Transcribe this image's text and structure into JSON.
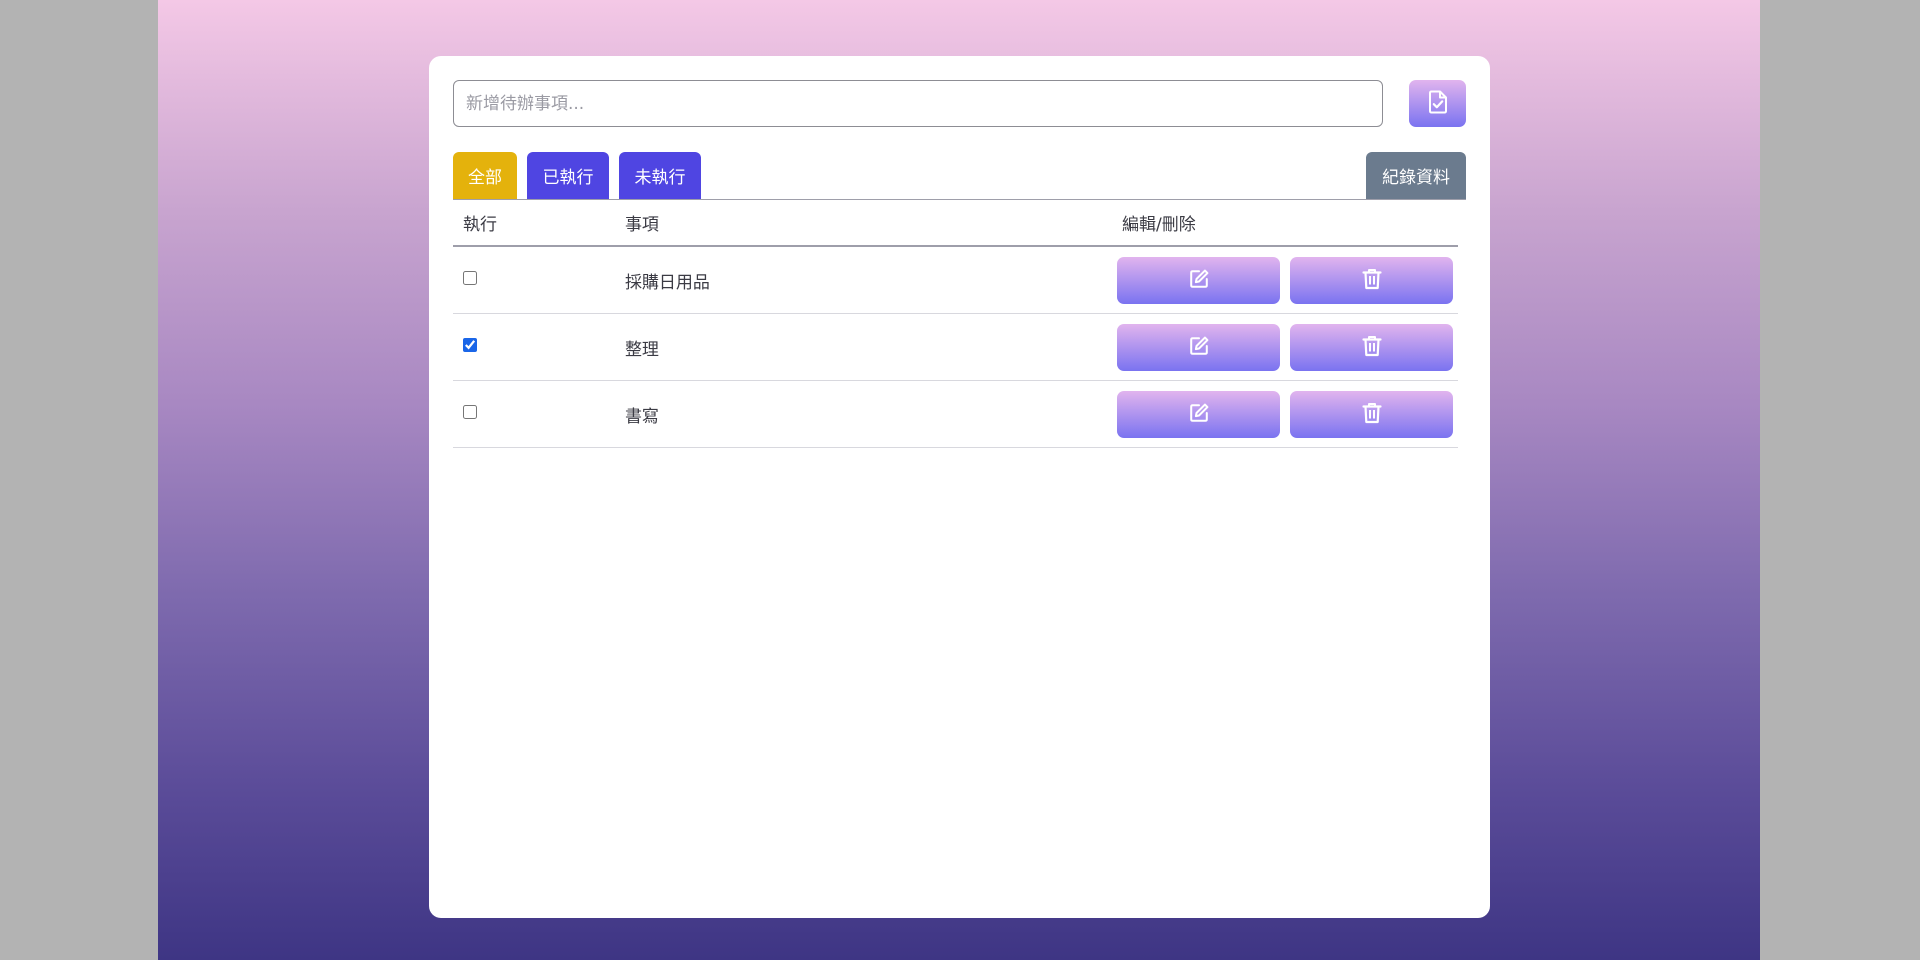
{
  "input": {
    "value": "",
    "placeholder": "新增待辦事項..."
  },
  "add_button": {
    "icon": "file-check-icon"
  },
  "tabs": {
    "all": "全部",
    "done": "已執行",
    "undone": "未執行",
    "record": "紀錄資料"
  },
  "colors": {
    "tab_all": "#e4b20c",
    "tab_filter": "#4f45e2",
    "tab_record": "#6b7b8e",
    "button_gradient_top": "#e1b4ee",
    "button_gradient_bottom": "#7a73f0"
  },
  "table": {
    "headers": {
      "execute": "執行",
      "item": "事項",
      "edit_delete": "編輯/刪除"
    },
    "rows": [
      {
        "label": "採購日用品",
        "checked": false
      },
      {
        "label": "整理",
        "checked": true
      },
      {
        "label": "書寫",
        "checked": false
      }
    ]
  },
  "icons": {
    "edit": "edit-icon",
    "delete": "trash-icon"
  }
}
